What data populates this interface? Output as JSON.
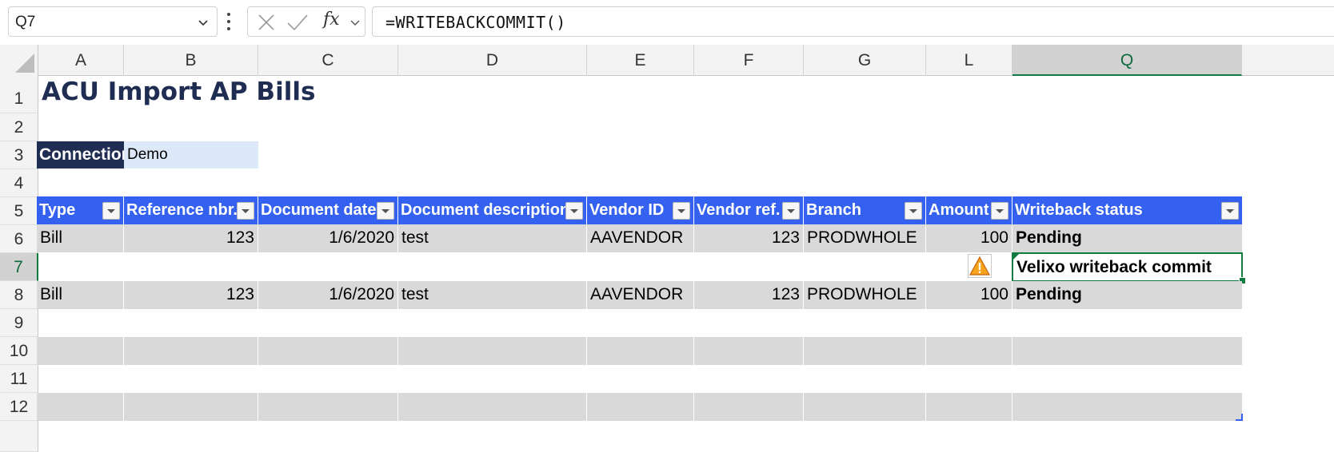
{
  "formula_bar": {
    "name_box": "Q7",
    "fx_label": "fx",
    "formula": "=WRITEBACKCOMMIT()"
  },
  "column_headers": [
    "A",
    "B",
    "C",
    "D",
    "E",
    "F",
    "G",
    "L",
    "Q"
  ],
  "row_headers": [
    "1",
    "2",
    "3",
    "4",
    "5",
    "6",
    "7",
    "8",
    "9",
    "10",
    "11",
    "12"
  ],
  "sheet": {
    "title": "ACU Import AP Bills",
    "connection_label": "Connection",
    "connection_value": "Demo",
    "table_headers": [
      "Type",
      "Reference nbr.",
      "Document date",
      "Document description",
      "Vendor ID",
      "Vendor ref.",
      "Branch",
      "Amount",
      "Writeback status"
    ],
    "rows": [
      [
        "Bill",
        "123",
        "1/6/2020",
        "test",
        "AAVENDOR",
        "123",
        "PRODWHOLE",
        "100",
        "Pending"
      ],
      [
        "Bill",
        "123",
        "1/6/2020",
        "test",
        "AAVENDOR",
        "123",
        "PRODWHOLE",
        "100",
        "Pending"
      ]
    ],
    "commit_cell_text": "Velixo writeback commit",
    "warning_icon": "warning-triangle-icon"
  },
  "colors": {
    "title": "#1f2d52",
    "header_fill": "#3561f0",
    "band_fill": "#d9d9d9",
    "selection": "#107c41"
  }
}
